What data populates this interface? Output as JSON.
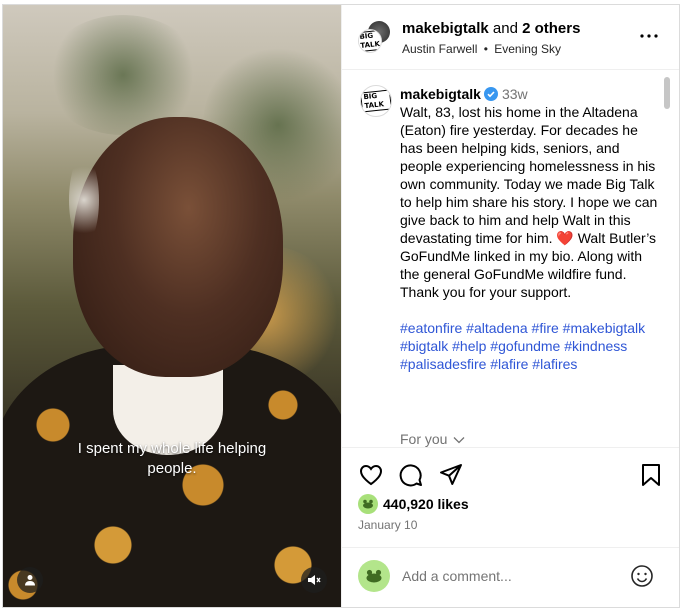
{
  "header": {
    "username": "makebigtalk",
    "and_text": "and",
    "others": "2 others",
    "collaborator": "Austin Farwell",
    "separator": "•",
    "audio": "Evening Sky",
    "logo_text": "BIG TALK"
  },
  "media": {
    "caption_line1": "I spent my whole life helping",
    "caption_line2": "people."
  },
  "post": {
    "author": "makebigtalk",
    "age": "33w",
    "body_part1": "Walt, 83, lost his home in the Altadena (Eaton) fire yesterday. For decades he has been helping kids, seniors, and people experiencing homelessness in his own community. Today we made Big Talk to help him share his story. I hope we can give back to him and help Walt in this devastating time for him. ",
    "heart_emoji": "❤️",
    "body_part2": " Walt Butler’s GoFundMe linked in my bio. Along with the general GoFundMe wildfire fund. Thank you for your support.",
    "hashtags": "#eatonfire #altadena #fire #makebigtalk #bigtalk #help #gofundme #kindness #palisadesfire #lafire #lafires",
    "for_you": "For you"
  },
  "actions": {
    "likes": "440,920 likes",
    "date": "January 10"
  },
  "comment": {
    "placeholder": "Add a comment..."
  },
  "colors": {
    "hashtag": "#2f56d6",
    "verified": "#3897f0",
    "heart": "#e0245e"
  }
}
